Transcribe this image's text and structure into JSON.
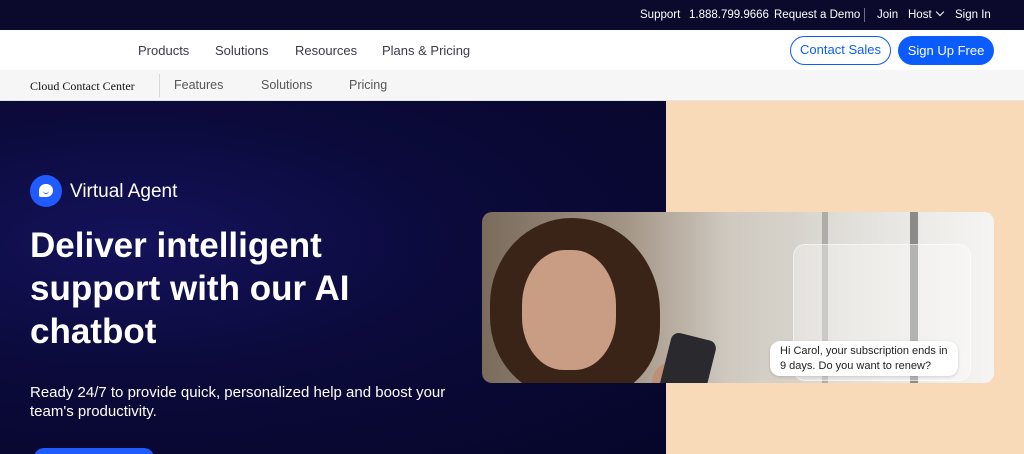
{
  "utility": {
    "support": "Support",
    "phone": "1.888.799.9666",
    "request_demo": "Request a Demo",
    "join": "Join",
    "host": "Host",
    "sign_in": "Sign In"
  },
  "nav": {
    "items": [
      "Products",
      "Solutions",
      "Resources",
      "Plans & Pricing"
    ],
    "contact_sales": "Contact Sales",
    "sign_up": "Sign Up Free"
  },
  "subnav": {
    "brand": "Cloud Contact Center",
    "items": [
      "Features",
      "Solutions",
      "Pricing"
    ]
  },
  "hero": {
    "badge": "Virtual Agent",
    "title": "Deliver intelligent support with our AI chatbot",
    "subtitle": "Ready 24/7 to provide quick, personalized help and boost your team's productivity.",
    "chat_message": "Hi Carol, your subscription ends in 9 days. Do you want to renew?"
  },
  "colors": {
    "utility_bg": "#0b0a2c",
    "brand_blue": "#0b5cff",
    "hero_dark": "#0b0a3a",
    "hero_peach": "#f9dab8"
  }
}
